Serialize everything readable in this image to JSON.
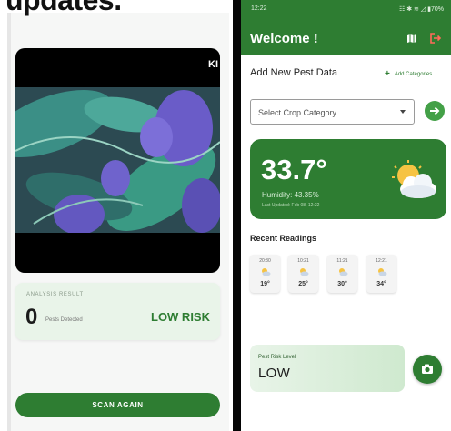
{
  "left_screen": {
    "heading_fragment": "updates.",
    "video_corner_text": "KI",
    "analysis": {
      "label": "ANALYSIS RESULT",
      "pest_count": "0",
      "pest_count_label": "Pests Detected",
      "risk": "LOW RISK"
    },
    "scan_again_label": "SCAN AGAIN"
  },
  "right_screen": {
    "status_bar": {
      "time": "12:22",
      "icons_text": "☷ ✱ ≋ ◿ ▮70%"
    },
    "appbar": {
      "title": "Welcome !",
      "map_icon": "map-icon",
      "logout_icon": "logout-icon"
    },
    "add_pest": {
      "title": "Add New Pest Data",
      "add_category_label": "Add Categories",
      "select_placeholder": "Select Crop Category"
    },
    "weather": {
      "temperature": "33.7°",
      "humidity": "Humidity: 43.35%",
      "last_updated": "Last Updated: Feb 08, 12:22",
      "icon": "partly-cloudy-icon"
    },
    "recent_readings": {
      "title": "Recent Readings",
      "items": [
        {
          "time": "20:30",
          "temp": "19°"
        },
        {
          "time": "10:21",
          "temp": "25°"
        },
        {
          "time": "11:21",
          "temp": "30°"
        },
        {
          "time": "12:21",
          "temp": "34°"
        }
      ]
    },
    "pest_risk": {
      "label": "Pest Risk Level",
      "value": "LOW"
    },
    "fab_icon": "camera-icon"
  },
  "colors": {
    "primary_green": "#2e7d32",
    "accent_green": "#43a047",
    "card_tint": "#e9f4e9"
  }
}
